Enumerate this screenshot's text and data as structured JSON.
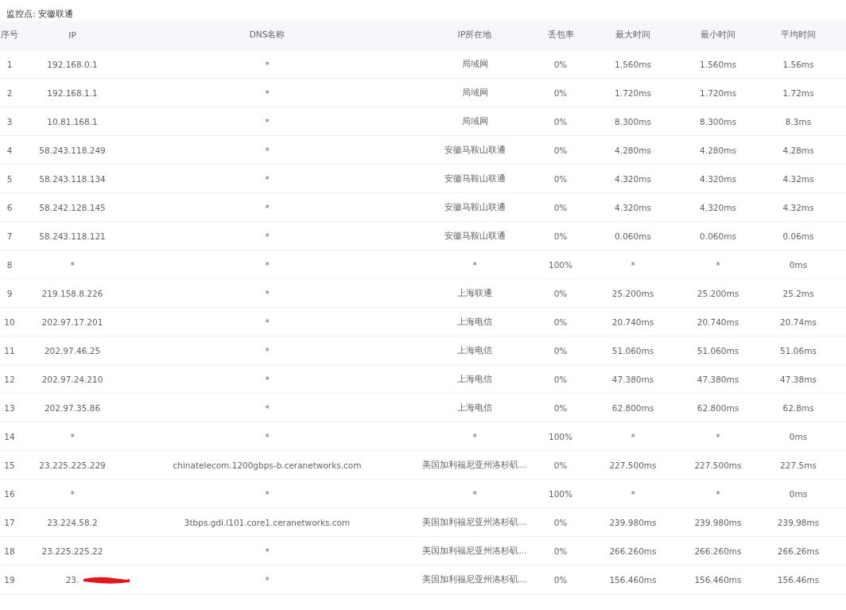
{
  "monitor": {
    "label": "监控点: 安徽联通"
  },
  "table": {
    "columns": [
      "序号",
      "IP",
      "DNS名称",
      "IP所在地",
      "丢包率",
      "最大时间",
      "最小时间",
      "平均时间"
    ],
    "rows": [
      {
        "cells": [
          "1",
          "192.168.0.1",
          "*",
          "局域网",
          "0%",
          "1.560ms",
          "1.560ms",
          "1.56ms"
        ]
      },
      {
        "cells": [
          "2",
          "192.168.1.1",
          "*",
          "局域网",
          "0%",
          "1.720ms",
          "1.720ms",
          "1.72ms"
        ]
      },
      {
        "cells": [
          "3",
          "10.81.168.1",
          "*",
          "局域网",
          "0%",
          "8.300ms",
          "8.300ms",
          "8.3ms"
        ]
      },
      {
        "cells": [
          "4",
          "58.243.118.249",
          "*",
          "安徽马鞍山联通",
          "0%",
          "4.280ms",
          "4.280ms",
          "4.28ms"
        ]
      },
      {
        "cells": [
          "5",
          "58.243.118.134",
          "*",
          "安徽马鞍山联通",
          "0%",
          "4.320ms",
          "4.320ms",
          "4.32ms"
        ]
      },
      {
        "cells": [
          "6",
          "58.242.128.145",
          "*",
          "安徽马鞍山联通",
          "0%",
          "4.320ms",
          "4.320ms",
          "4.32ms"
        ]
      },
      {
        "cells": [
          "7",
          "58.243.118.121",
          "*",
          "安徽马鞍山联通",
          "0%",
          "0.060ms",
          "0.060ms",
          "0.06ms"
        ]
      },
      {
        "cells": [
          "8",
          "*",
          "*",
          "*",
          "100%",
          "*",
          "*",
          "0ms"
        ]
      },
      {
        "cells": [
          "9",
          "219.158.8.226",
          "*",
          "上海联通",
          "0%",
          "25.200ms",
          "25.200ms",
          "25.2ms"
        ]
      },
      {
        "cells": [
          "10",
          "202.97.17.201",
          "*",
          "上海电信",
          "0%",
          "20.740ms",
          "20.740ms",
          "20.74ms"
        ]
      },
      {
        "cells": [
          "11",
          "202.97.46.25",
          "*",
          "上海电信",
          "0%",
          "51.060ms",
          "51.060ms",
          "51.06ms"
        ]
      },
      {
        "cells": [
          "12",
          "202.97.24.210",
          "*",
          "上海电信",
          "0%",
          "47.380ms",
          "47.380ms",
          "47.38ms"
        ]
      },
      {
        "cells": [
          "13",
          "202.97.35.86",
          "*",
          "上海电信",
          "0%",
          "62.800ms",
          "62.800ms",
          "62.8ms"
        ]
      },
      {
        "cells": [
          "14",
          "*",
          "*",
          "*",
          "100%",
          "*",
          "*",
          "0ms"
        ]
      },
      {
        "cells": [
          "15",
          "23.225.225.229",
          "chinatelecom.1200gbps-b.ceranetworks.com",
          "美国加利福尼亚州洛杉矶...",
          "0%",
          "227.500ms",
          "227.500ms",
          "227.5ms"
        ]
      },
      {
        "cells": [
          "16",
          "*",
          "*",
          "*",
          "100%",
          "*",
          "*",
          "0ms"
        ]
      },
      {
        "cells": [
          "17",
          "23.224.58.2",
          "3tbps.gdi.l101.core1.ceranetworks.com",
          "美国加利福尼亚州洛杉矶...",
          "0%",
          "239.980ms",
          "239.980ms",
          "239.98ms"
        ]
      },
      {
        "cells": [
          "18",
          "23.225.225.22",
          "*",
          "美国加利福尼亚州洛杉矶...",
          "0%",
          "266.260ms",
          "266.260ms",
          "266.26ms"
        ]
      },
      {
        "cells": [
          "19",
          "23.",
          "*",
          "美国加利福尼亚州洛杉矶...",
          "0%",
          "156.460ms",
          "156.460ms",
          "156.46ms"
        ],
        "redacted": true
      }
    ]
  }
}
